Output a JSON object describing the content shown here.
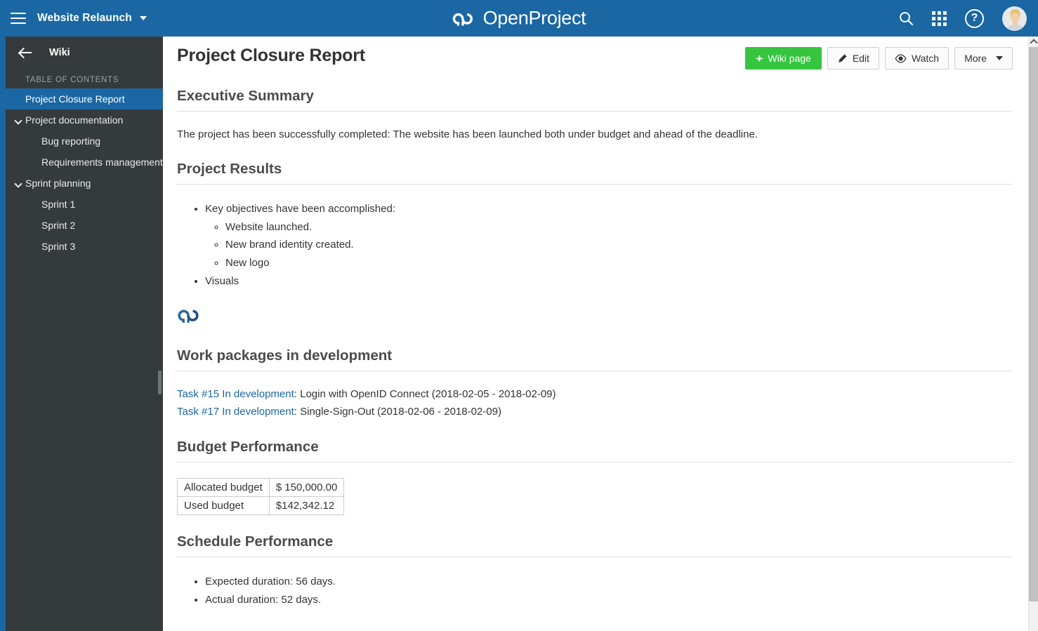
{
  "header": {
    "menu_icon": "hamburger-icon",
    "project_name": "Website Relaunch",
    "logo_text": "OpenProject",
    "search_icon": "search-icon",
    "modules_icon": "grid-modules-icon",
    "help_icon": "help-icon",
    "help_glyph": "?",
    "avatar_icon": "user-avatar"
  },
  "sidebar": {
    "back_icon": "back-arrow-icon",
    "title": "Wiki",
    "toc_label": "TABLE OF CONTENTS",
    "items": [
      {
        "label": "Project Closure Report",
        "level": 1,
        "active": true,
        "expandable": false
      },
      {
        "label": "Project documentation",
        "level": 1,
        "active": false,
        "expandable": true
      },
      {
        "label": "Bug reporting",
        "level": 2,
        "active": false,
        "expandable": false
      },
      {
        "label": "Requirements management",
        "level": 2,
        "active": false,
        "expandable": false
      },
      {
        "label": "Sprint planning",
        "level": 1,
        "active": false,
        "expandable": true
      },
      {
        "label": "Sprint 1",
        "level": 2,
        "active": false,
        "expandable": false
      },
      {
        "label": "Sprint 2",
        "level": 2,
        "active": false,
        "expandable": false
      },
      {
        "label": "Sprint 3",
        "level": 2,
        "active": false,
        "expandable": false
      }
    ]
  },
  "page": {
    "title": "Project Closure Report"
  },
  "toolbar": {
    "wiki_page_label": "Wiki page",
    "wiki_page_plus": "+",
    "edit_label": "Edit",
    "edit_icon": "pencil-icon",
    "watch_label": "Watch",
    "watch_icon": "eye-icon",
    "more_label": "More",
    "more_icon": "chevron-down-icon"
  },
  "sections": {
    "executive_summary": {
      "heading": "Executive Summary",
      "paragraph": "The project has been successfully completed: The website has been launched both under budget and ahead of the deadline."
    },
    "project_results": {
      "heading": "Project Results",
      "bullets": [
        {
          "text": "Key objectives have been accomplished:",
          "children": [
            "Website launched.",
            "New brand identity created.",
            "New logo"
          ]
        },
        {
          "text": "Visuals",
          "children": []
        }
      ],
      "embedded_image": "openproject-logo-image"
    },
    "work_packages": {
      "heading": "Work packages in development",
      "items": [
        {
          "link": "Task #15 In development",
          "rest": ": Login with OpenID Connect (2018-02-05 - 2018-02-09)"
        },
        {
          "link": "Task #17 In development",
          "rest": ": Single-Sign-Out (2018-02-06 - 2018-02-09)"
        }
      ]
    },
    "budget": {
      "heading": "Budget Performance",
      "rows": [
        {
          "label": "Allocated budget",
          "value": "$ 150,000.00"
        },
        {
          "label": "Used budget",
          "value": "$142,342.12"
        }
      ]
    },
    "schedule": {
      "heading": "Schedule Performance",
      "bullets": [
        "Expected duration: 56 days.",
        "Actual duration: 52 days."
      ]
    }
  },
  "scrollbar": {
    "up_arrow_icon": "scroll-up-arrow-icon"
  },
  "colors": {
    "header_blue": "#1a67a3",
    "sidebar_dark": "#353a3d",
    "accent_green": "#35c53f",
    "link_blue": "#1a67a3"
  }
}
